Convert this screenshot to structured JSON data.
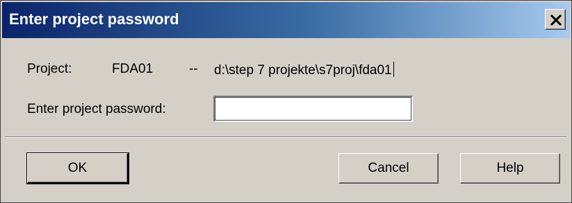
{
  "window": {
    "title": "Enter project password",
    "close_label": "X"
  },
  "project_info": {
    "project_label": "Project:",
    "project_name": "FDA01",
    "separator": "--",
    "project_path": "d:\\step 7 projekte\\s7proj\\fda01"
  },
  "password": {
    "label": "Enter project password:",
    "value": "",
    "placeholder": ""
  },
  "buttons": {
    "ok": "OK",
    "cancel": "Cancel",
    "help": "Help"
  }
}
